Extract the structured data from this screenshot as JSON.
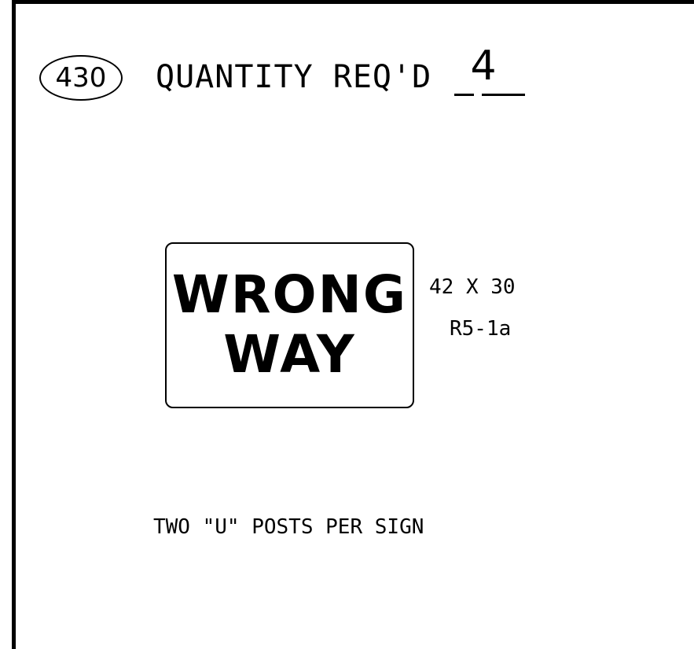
{
  "item_number": "430",
  "quantity": {
    "label": "QUANTITY REQ'D",
    "value": "4"
  },
  "sign": {
    "legend_line_1": "WRONG",
    "legend_line_2": "WAY",
    "size": "42 X 30",
    "code": "R5-1a"
  },
  "note": "TWO \"U\" POSTS PER SIGN",
  "colors": {
    "ink": "#000000",
    "background": "#ffffff"
  }
}
